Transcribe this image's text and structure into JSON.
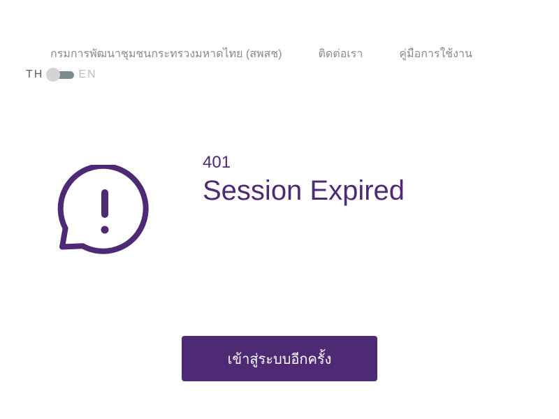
{
  "nav": {
    "links": [
      {
        "label": "กรมการพัฒนาชุมชนกระทรวงมหาดไทย (สพสช)"
      },
      {
        "label": "ติดต่อเรา"
      },
      {
        "label": "คู่มือการใช้งาน"
      }
    ]
  },
  "language": {
    "th_label": "TH",
    "en_label": "EN",
    "selected": "TH"
  },
  "error": {
    "icon": "message-alert-icon",
    "code": "401",
    "title": "Session Expired"
  },
  "actions": {
    "login_label": "เข้าสู่ระบบอีกครั้ง"
  },
  "colors": {
    "accent": "#4e2a75",
    "nav_text": "#8a8a8a",
    "toggle_track": "#7e8b8e",
    "toggle_knob": "#d4d4d4"
  }
}
